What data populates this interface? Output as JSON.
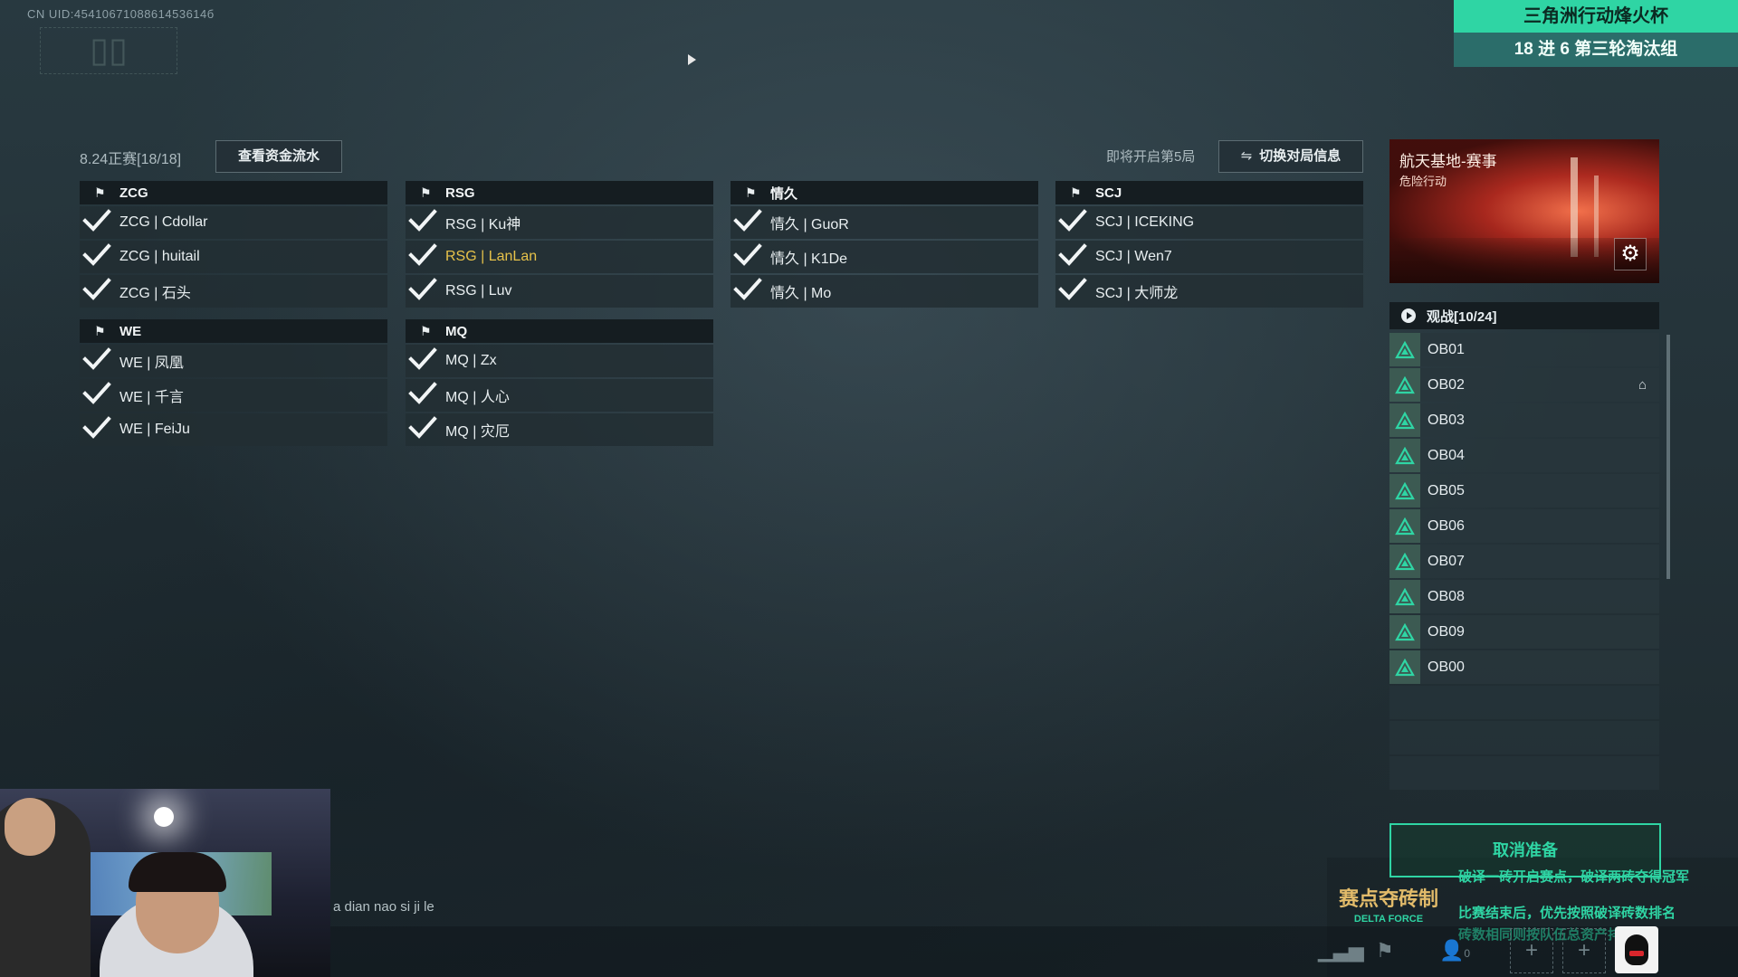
{
  "uid_text": "CN UID:4541067108861453614б",
  "banner": {
    "title": "三角洲行动烽火杯",
    "subtitle": "18 进 6 第三轮淘汰组"
  },
  "header": {
    "match_label": "8.24正赛[18/18]",
    "funds_button": "查看资金流水",
    "next_round": "即将开启第5局",
    "switch_button": "切换对局信息"
  },
  "teams": [
    {
      "name": "ZCG",
      "players": [
        "ZCG | Cdollar",
        "ZCG | huitail",
        "ZCG | 石头"
      ]
    },
    {
      "name": "RSG",
      "players": [
        "RSG | Ku神",
        "RSG | LanLan",
        "RSG | Luv"
      ],
      "highlight_index": 1,
      "highlight_color": "#e7c24a"
    },
    {
      "name": "情久",
      "players": [
        "情久 | GuoR",
        "情久 | K1De",
        "情久 | Mo"
      ]
    },
    {
      "name": "SCJ",
      "players": [
        "SCJ | ICEKING",
        "SCJ | Wen7",
        "SCJ | 大师龙"
      ]
    },
    {
      "name": "WE",
      "players": [
        "WE | 凤凰",
        "WE | 千言",
        "WE | FeiJu"
      ]
    },
    {
      "name": "MQ",
      "players": [
        "MQ | Zx",
        "MQ | 人心",
        "MQ | 灾厄"
      ]
    }
  ],
  "map": {
    "name": "航天基地-赛事",
    "mode": "危险行动",
    "settings_icon": "gear-icon"
  },
  "spectators": {
    "title": "观战[10/24]",
    "slots": [
      "OB01",
      "OB02",
      "OB03",
      "OB04",
      "OB05",
      "OB06",
      "OB07",
      "OB08",
      "OB09",
      "OB00"
    ],
    "host_slot": "OB02"
  },
  "ready": {
    "cancel_button": "取消准备"
  },
  "rules": {
    "logo_title": "赛点夺砖制",
    "logo_sub": "DELTA FORCE",
    "line1": "破译一砖开启赛点，破译两砖夺得冠军",
    "line2": "比赛结束后，优先按照破译砖数排名",
    "line3": "砖数相同则按队伍总资产排名"
  },
  "chat": {
    "text": "a dian nao si ji le"
  },
  "bottom_bar": {
    "friends_count": "0"
  },
  "colors": {
    "accent": "#2fd5a4",
    "highlight": "#e7c24a",
    "panel_dark": "#151d21"
  }
}
